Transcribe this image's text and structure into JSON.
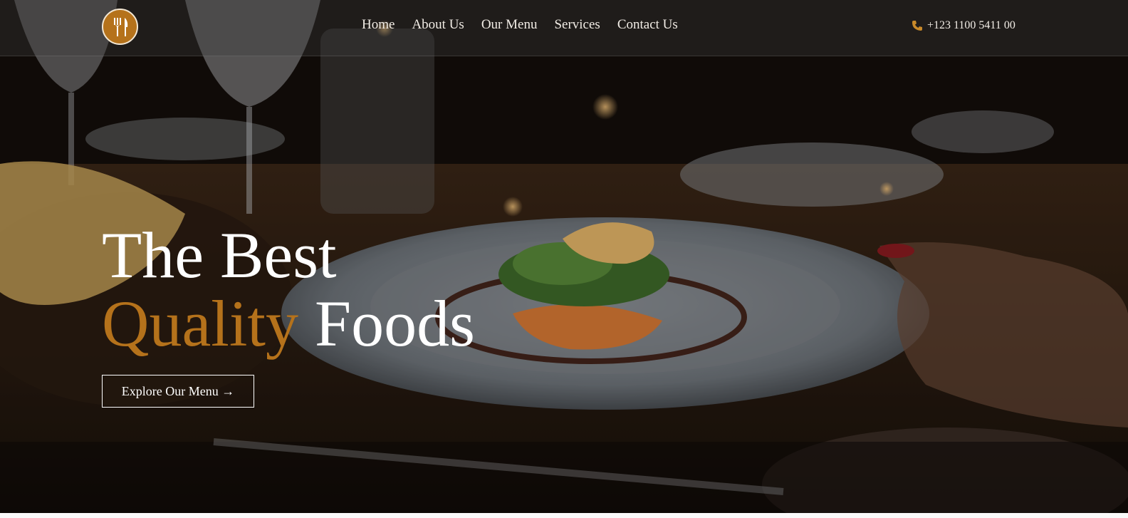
{
  "brand": {
    "logo_icon": "fork-knife-icon",
    "accent": "#b5721b"
  },
  "nav": {
    "items": [
      {
        "label": "Home"
      },
      {
        "label": "About Us"
      },
      {
        "label": "Our Menu"
      },
      {
        "label": "Services"
      },
      {
        "label": "Contact Us"
      }
    ]
  },
  "contact": {
    "phone_icon": "phone-icon",
    "phone": "+123 1100 5411 00"
  },
  "hero": {
    "line1": "The Best",
    "line2_accent": "Quality",
    "line2_rest": " Foods",
    "cta_label": "Explore Our Menu →"
  }
}
